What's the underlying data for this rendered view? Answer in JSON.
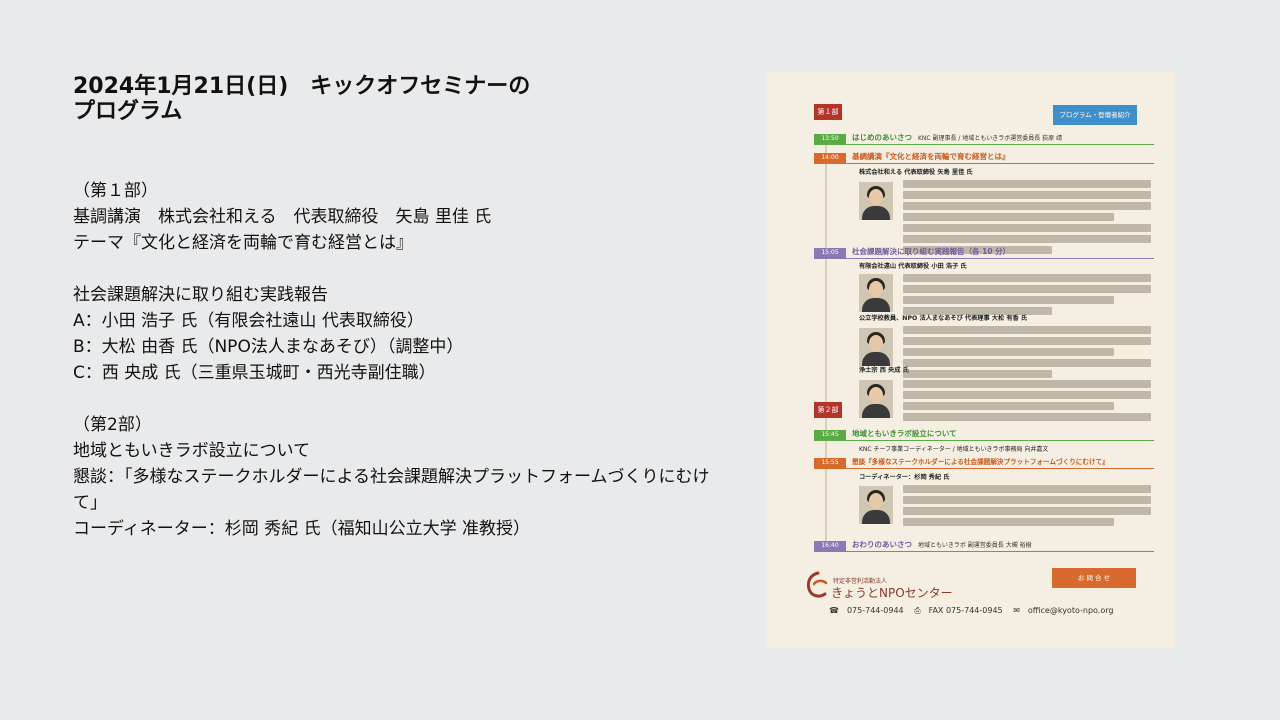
{
  "slide": {
    "title_line1": "2024年1月21日(日)　キックオフセミナーの",
    "title_line2": "プログラム",
    "part1_heading": "（第１部）",
    "keynote": "基調講演　株式会社和える　代表取締役　矢島 里佳 氏",
    "theme": "テーマ『文化と経済を両輪で育む経営とは』",
    "reports_heading": "社会課題解決に取り組む実践報告",
    "report_a": " A：小田 浩子 氏（有限会社遠山 代表取締役）",
    "report_b": " B：大松 由香 氏（NPO法人まなあそび）（調整中）",
    "report_c": " C：西 央成 氏（三重県玉城町・西光寺副住職）",
    "part2_heading": "（第2部）",
    "lab": "地域ともいきラボ設立について",
    "discussion": "懇談：「多様なステークホルダーによる社会課題解決プラットフォームづくりにむけて」",
    "coordinator": "コーディネーター：杉岡 秀紀 氏（福知山公立大学 准教授）"
  },
  "flyer": {
    "part1": "第１部",
    "part2": "第２部",
    "badge": "プログラム・登壇者紹介",
    "t1": "13:50",
    "h1": "はじめのあいさつ",
    "h1_sub": "KNC 副理事長 / 地域ともいきラボ運営委員長 荻原 靖",
    "t2": "14:00",
    "h2": "基調講演『文化と経済を両輪で育む経営とは』",
    "s2": "株式会社和える 代表取締役 矢島 里佳 氏",
    "t3": "15:05",
    "h3": "社会課題解決に取り組む実践報告（各 10 分）",
    "s3a": "有限会社遠山 代表取締役 小田 浩子 氏",
    "s3b": "公立学校教員、NPO 法人まなあそび 代表理事 大松 有香 氏",
    "s3c": "浄土宗 西 央成 氏",
    "t4": "15:45",
    "h4": "地域ともいきラボ設立について",
    "s4": "KNC チーフ事業コーディネーター / 地域ともいきラボ事務局 向井嘉文",
    "t5": "15:55",
    "h5": "懇談『多様なステークホルダーによる社会課題解決プラットフォームづくりにむけて』",
    "s5": "コーディネーター：杉岡 秀紀 氏",
    "t6": "16:40",
    "h6": "おわりのあいさつ",
    "h6_sub": "地域ともいきラボ 副運営委員長 大槻 裕樹",
    "contact_btn": "お 問 合 せ",
    "org_small": "特定非営利活動法人",
    "org_name": "きょうとNPOセンター",
    "tel": "075-744-0944",
    "fax": "FAX 075-744-0945",
    "email": "office@kyoto-npo.org"
  },
  "colors": {
    "background": "#e9eaec",
    "flyer_bg": "#f4efe2",
    "accent_red": "#b5342a",
    "accent_blue": "#3f8fca",
    "accent_green": "#5aaa46",
    "accent_orange": "#d86a2b",
    "accent_purple": "#8a79b3"
  }
}
